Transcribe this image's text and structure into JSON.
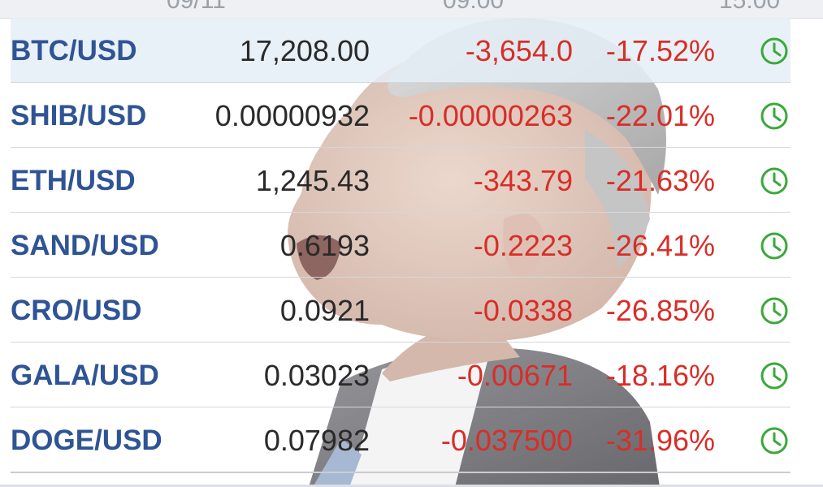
{
  "header": {
    "columns": [
      "09/11",
      "09:00",
      "15:00"
    ]
  },
  "quotes": [
    {
      "symbol": "BTC/USD",
      "last": "17,208.00",
      "change": "-3,654.0",
      "change_pct": "-17.52%",
      "selected": true
    },
    {
      "symbol": "SHIB/USD",
      "last": "0.00000932",
      "change": "-0.00000263",
      "change_pct": "-22.01%",
      "selected": false
    },
    {
      "symbol": "ETH/USD",
      "last": "1,245.43",
      "change": "-343.79",
      "change_pct": "-21.63%",
      "selected": false
    },
    {
      "symbol": "SAND/USD",
      "last": "0.6193",
      "change": "-0.2223",
      "change_pct": "-26.41%",
      "selected": false
    },
    {
      "symbol": "CRO/USD",
      "last": "0.0921",
      "change": "-0.0338",
      "change_pct": "-26.85%",
      "selected": false
    },
    {
      "symbol": "GALA/USD",
      "last": "0.03023",
      "change": "-0.00671",
      "change_pct": "-18.16%",
      "selected": false
    },
    {
      "symbol": "DOGE/USD",
      "last": "0.07982",
      "change": "-0.037500",
      "change_pct": "-31.96%",
      "selected": false
    }
  ],
  "icons": {
    "row_status": "clock-icon"
  },
  "colors": {
    "symbol": "#2f5495",
    "negative": "#d92d27",
    "price": "#2a2a2a",
    "clock": "#3aa83a",
    "selected_row": "#e5eef7"
  }
}
